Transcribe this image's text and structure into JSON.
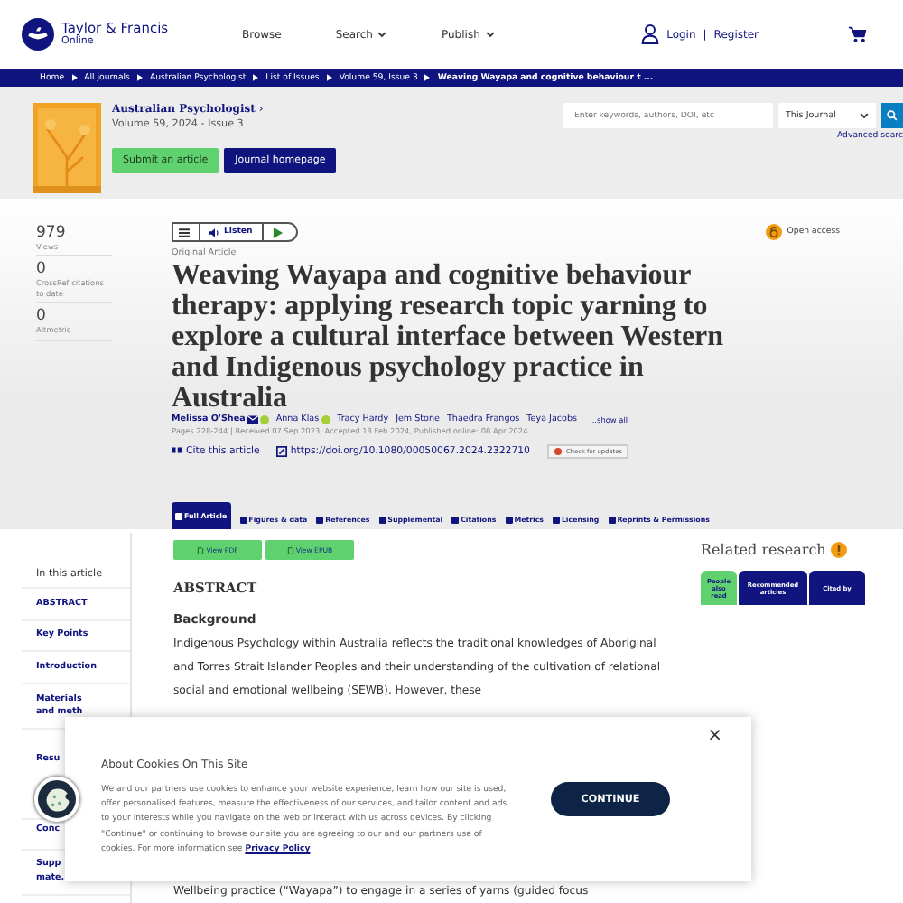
{
  "header": {
    "logo_line1": "Taylor & Francis",
    "logo_line2": "Online",
    "nav": [
      {
        "label": "Browse",
        "dropdown": false
      },
      {
        "label": "Search",
        "dropdown": true
      },
      {
        "label": "Publish",
        "dropdown": true
      }
    ],
    "login": "Login",
    "separator": "|",
    "register": "Register"
  },
  "breadcrumbs": [
    "Home",
    "All journals",
    "Australian Psychologist",
    "List of Issues",
    "Volume 59, Issue 3",
    "Weaving Wayapa and cognitive behaviour t ..."
  ],
  "journal": {
    "name": "Australian Psychologist",
    "arrow": "›",
    "issue": "Volume 59, 2024 - Issue 3",
    "submit": "Submit an article",
    "homepage": "Journal homepage"
  },
  "search": {
    "placeholder": "Enter keywords, authors, DOI, etc",
    "scope": "This Journal",
    "advanced": "Advanced searc"
  },
  "metrics": [
    {
      "value": "979",
      "label": "Views"
    },
    {
      "value": "0",
      "label": "CrossRef citations to date"
    },
    {
      "value": "0",
      "label": "Altmetric"
    }
  ],
  "article": {
    "listen": "Listen",
    "open_access": "Open access",
    "type": "Original Article",
    "title": "Weaving Wayapa and cognitive behaviour therapy: applying research topic yarning to explore a cultural interface between Western and Indigenous psychology practice in Australia",
    "authors": [
      {
        "name": "Melissa O'Shea",
        "email": true,
        "orcid": true
      },
      {
        "name": "Anna Klas",
        "email": false,
        "orcid": true
      },
      {
        "name": "Tracy Hardy",
        "email": false,
        "orcid": false
      },
      {
        "name": "Jem Stone",
        "email": false,
        "orcid": false
      },
      {
        "name": "Thaedra Frangos",
        "email": false,
        "orcid": false
      },
      {
        "name": "Teya Jacobs",
        "email": false,
        "orcid": false
      }
    ],
    "show_all": "...show all",
    "dates": "Pages 228-244 | Received 07 Sep 2023, Accepted 18 Feb 2024, Published online: 08 Apr 2024",
    "cite": "Cite this article",
    "doi": "https://doi.org/10.1080/00050067.2024.2322710",
    "check_updates": "Check for updates"
  },
  "tabs": [
    {
      "label": "Full Article",
      "selected": true
    },
    {
      "label": "Figures & data",
      "selected": false
    },
    {
      "label": "References",
      "selected": false
    },
    {
      "label": "Supplemental",
      "selected": false
    },
    {
      "label": "Citations",
      "selected": false
    },
    {
      "label": "Metrics",
      "selected": false
    },
    {
      "label": "Licensing",
      "selected": false
    },
    {
      "label": "Reprints & Permissions",
      "selected": false
    }
  ],
  "downloads": [
    "View PDF",
    "View EPUB"
  ],
  "sidebar": {
    "heading": "In this article",
    "items": [
      "ABSTRACT",
      "Key Points",
      "Introduction",
      "Materials and meth",
      "Resu",
      "Conc",
      "Supp mate."
    ]
  },
  "abstract": {
    "heading": "ABSTRACT",
    "subheading": "Background",
    "paragraph": "Indigenous Psychology within Australia reflects the traditional knowledges of Aboriginal and Torres Strait Islander Peoples and their understanding of the cultivation of relational social and emotional wellbeing (SEWB). However, these",
    "continuation": "Wellbeing practice (“Wayapa”) to engage in a series of yarns (guided focus"
  },
  "related": {
    "title": "Related research",
    "tabs": [
      {
        "label": "People also read",
        "selected": true
      },
      {
        "label": "Recommended articles",
        "selected": false
      },
      {
        "label": "Cited by",
        "selected": false
      }
    ]
  },
  "cookie": {
    "title": "About Cookies On This Site",
    "body": "We and our partners use cookies to enhance your website experience, learn how our site is used, offer personalised features, measure the effectiveness of our services, and tailor content and ads to your interests while you navigate on the web or interact with us across devices. By clicking \"Continue\" or continuing to browse our site you are agreeing to our and our partners use of cookies. For more information see",
    "link": "Privacy Policy",
    "button": "CONTINUE",
    "close": "×"
  }
}
